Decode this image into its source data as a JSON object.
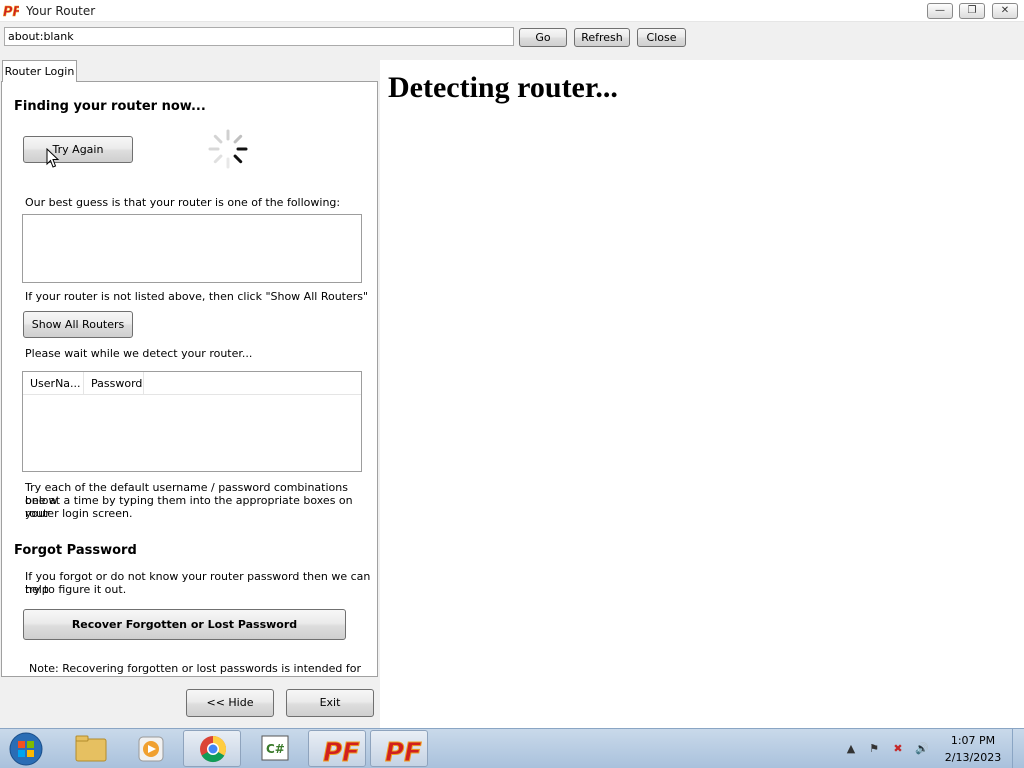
{
  "window": {
    "title": "Your Router"
  },
  "address_bar": {
    "url": "about:blank",
    "go_label": "Go",
    "refresh_label": "Refresh",
    "close_label": "Close"
  },
  "tab": {
    "label": "Router Login"
  },
  "finding": {
    "heading": "Finding your router now...",
    "try_again_label": "Try Again",
    "best_guess_text": "Our best guess is that your router is one of the following:",
    "not_listed_text": "If your router is not listed above, then click \"Show All Routers\"",
    "show_all_label": "Show All Routers",
    "wait_text": "Please wait while we detect your router..."
  },
  "credentials_table": {
    "columns": [
      "UserNa...",
      "Password"
    ]
  },
  "instructions": {
    "line1": "Try each of the default username / password combinations below",
    "line2": "one at a time by typing them into the appropriate boxes on your",
    "line3": "router login screen."
  },
  "forgot": {
    "heading": "Forgot Password",
    "line1": "If you forgot or do not know your router password then we can help",
    "line2": "try to figure it out.",
    "recover_label": "Recover Forgotten or Lost Password",
    "note": "Note: Recovering forgotten or lost passwords is intended for use"
  },
  "footer": {
    "hide_label": "<< Hide",
    "exit_label": "Exit"
  },
  "browser": {
    "heading": "Detecting router..."
  },
  "taskbar": {
    "items": [
      "start-button",
      "file-explorer",
      "media-player",
      "chrome",
      "csharp-editor",
      "portforward-app",
      "portforward-app-2"
    ],
    "time": "1:07 PM",
    "date": "2/13/2023"
  },
  "colors": {
    "accent_red": "#d01f1f",
    "accent_orange": "#f0a020",
    "taskbar": "#b9cde3"
  }
}
